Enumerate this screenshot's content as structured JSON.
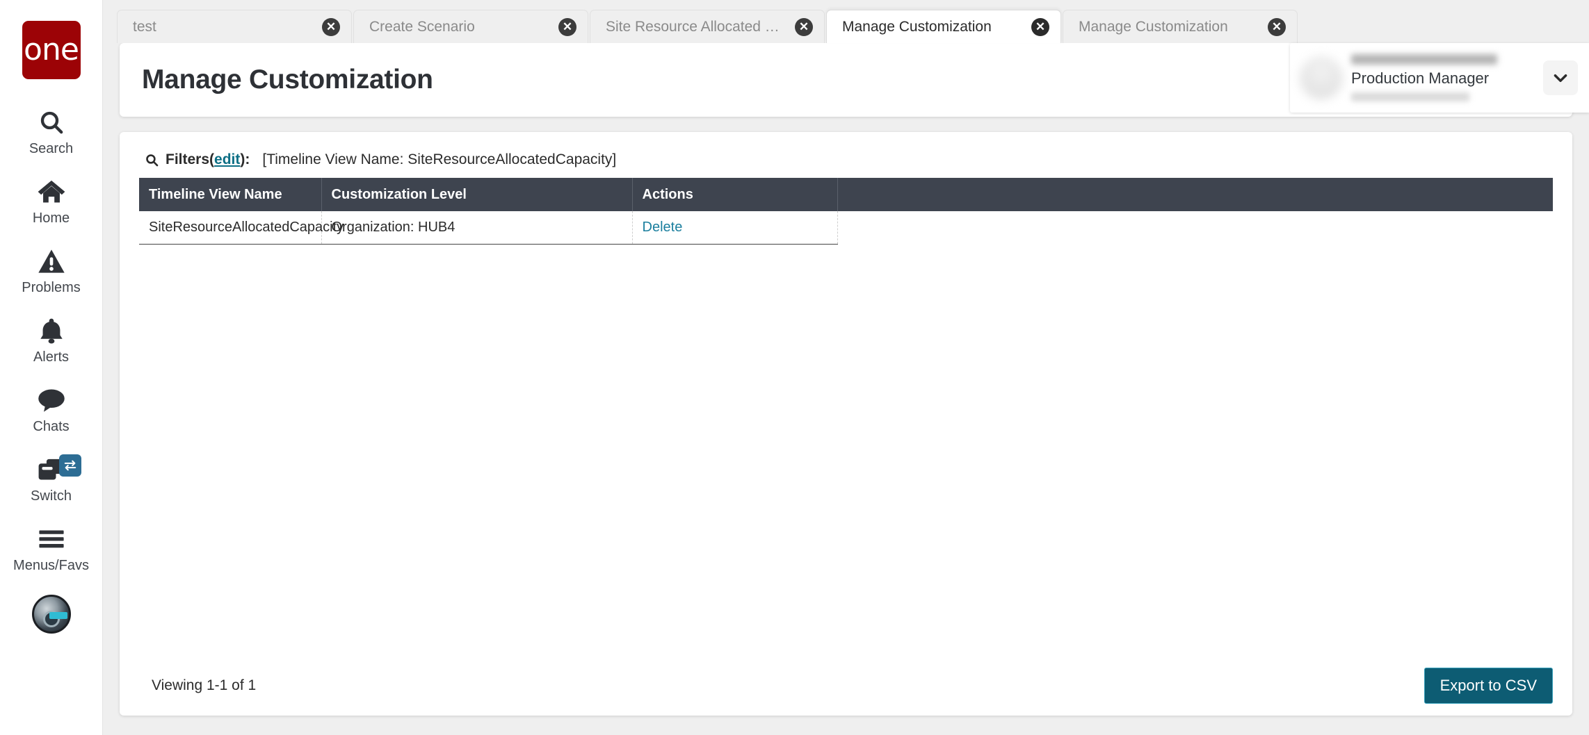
{
  "sidebar": {
    "logo_text": "one",
    "items": [
      {
        "label": "Search",
        "icon": "search-icon"
      },
      {
        "label": "Home",
        "icon": "home-icon"
      },
      {
        "label": "Problems",
        "icon": "warning-triangle-icon"
      },
      {
        "label": "Alerts",
        "icon": "bell-icon"
      },
      {
        "label": "Chats",
        "icon": "chat-bubble-icon"
      },
      {
        "label": "Switch",
        "icon": "windows-switch-icon"
      },
      {
        "label": "Menus/Favs",
        "icon": "hamburger-icon"
      }
    ],
    "assistant_avatar": "robot-assistant-avatar"
  },
  "tabs": [
    {
      "label": "test",
      "active": false
    },
    {
      "label": "Create Scenario",
      "active": false
    },
    {
      "label": "Site Resource Allocated Capacity",
      "active": false
    },
    {
      "label": "Manage Customization",
      "active": true
    },
    {
      "label": "Manage Customization",
      "active": false
    }
  ],
  "header": {
    "title": "Manage Customization",
    "actions": [
      {
        "name": "favorite-button",
        "icon": "star-icon"
      },
      {
        "name": "refresh-button",
        "icon": "refresh-icon"
      },
      {
        "name": "close-button",
        "icon": "x-icon"
      }
    ],
    "menu_button": "menus-favorites-button",
    "menu_badge_icon": "star-icon"
  },
  "user": {
    "name": "",
    "role": "Production Manager",
    "subtitle": "",
    "caret_icon": "chevron-down-icon"
  },
  "filters": {
    "icon": "search-icon",
    "label": "Filters",
    "edit_link": "edit",
    "open_paren": " (",
    "close_paren": "):",
    "value": "[Timeline View Name: SiteResourceAllocatedCapacity]"
  },
  "table": {
    "columns": [
      "Timeline View Name",
      "Customization Level",
      "Actions"
    ],
    "rows": [
      {
        "timeline_view_name": "SiteResourceAllocatedCapacity",
        "customization_level": "Organization: HUB4",
        "action": "Delete"
      }
    ]
  },
  "footer": {
    "viewing_text": "Viewing 1-1 of 1",
    "export_label": "Export to CSV"
  },
  "colors": {
    "brand_red": "#9c0306",
    "accent_teal": "#0d5c73",
    "table_header": "#3e444f",
    "link": "#1b7f9e",
    "page_bg": "#efefef"
  }
}
